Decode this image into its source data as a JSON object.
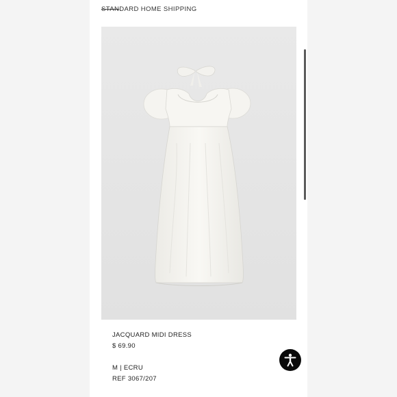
{
  "shipping": {
    "prefix": "STAN",
    "suffix": "DARD HOME SHIPPING"
  },
  "product": {
    "name": "JACQUARD MIDI DRESS",
    "price": "$ 69.90",
    "size_color": "M | ECRU",
    "ref": "REF 3067/207"
  },
  "icons": {
    "accessibility": "accessibility-icon"
  },
  "colors": {
    "photo_background": "#e6e6e6",
    "dress": "#f7f6f2",
    "accessibility_button": "#0a0a0a"
  }
}
